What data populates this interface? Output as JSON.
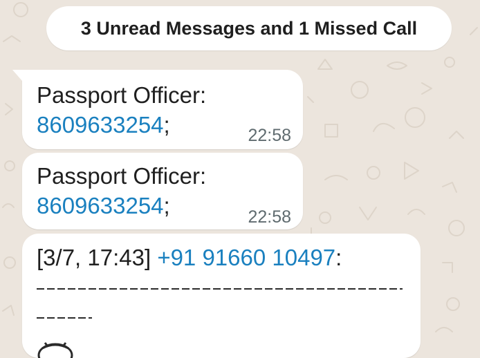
{
  "banner": {
    "text": "3 Unread Messages and 1 Missed Call"
  },
  "messages": [
    {
      "sender_label": "Passport Officer:",
      "phone": "8609633254",
      "suffix": ";",
      "time": "22:58"
    },
    {
      "sender_label": "Passport Officer:",
      "phone": "8609633254",
      "suffix": ";",
      "time": "22:58"
    },
    {
      "timestamp_prefix": "[3/7, 17:43]",
      "phone": "+91 91660 10497",
      "suffix": ":"
    }
  ],
  "colors": {
    "wallpaper": "#ece5dd",
    "bubble": "#ffffff",
    "link": "#1a80bf",
    "text": "#1f1f1f",
    "time": "#5f6b6f"
  },
  "icons": {
    "partial_emoji": "emoji-icon"
  }
}
